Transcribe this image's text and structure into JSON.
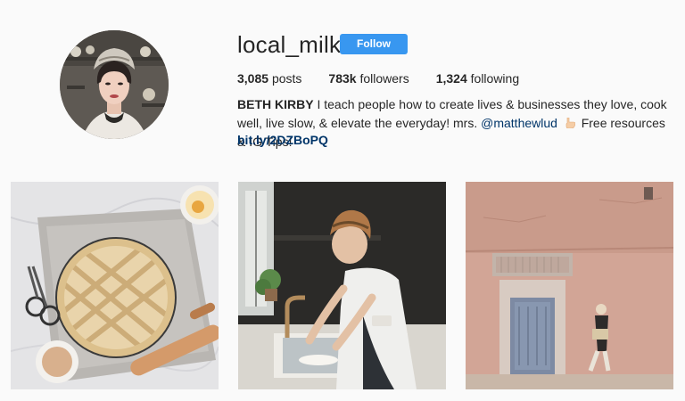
{
  "profile": {
    "username": "local_milk",
    "follow_label": "Follow",
    "stats": {
      "posts_count": "3,085",
      "posts_label": "posts",
      "followers_count": "783k",
      "followers_label": "followers",
      "following_count": "1,324",
      "following_label": "following"
    },
    "bio": {
      "name": "BETH KIRBY",
      "text_part1": "I teach people how to create lives & businesses they love, cook well, live slow, & elevate the everyday! mrs.",
      "mention": "@matthewlud",
      "hand_icon": "pointing-down-hand-emoji",
      "text_part2": "Free resources & IG Tips!"
    },
    "link": "bit.ly/2DZBoPQ"
  },
  "posts": [
    {
      "subject": "lattice pie on marble with scissors, rolling pin and bowls",
      "icon": "photo"
    },
    {
      "subject": "woman in headscarf washing dishes at kitchen sink",
      "icon": "photo"
    },
    {
      "subject": "pink clay wall with blue door and walking woman",
      "icon": "photo"
    }
  ],
  "colors": {
    "background": "#fafafa",
    "follow_button": "#3897f0",
    "link": "#003569",
    "text": "#262626"
  }
}
